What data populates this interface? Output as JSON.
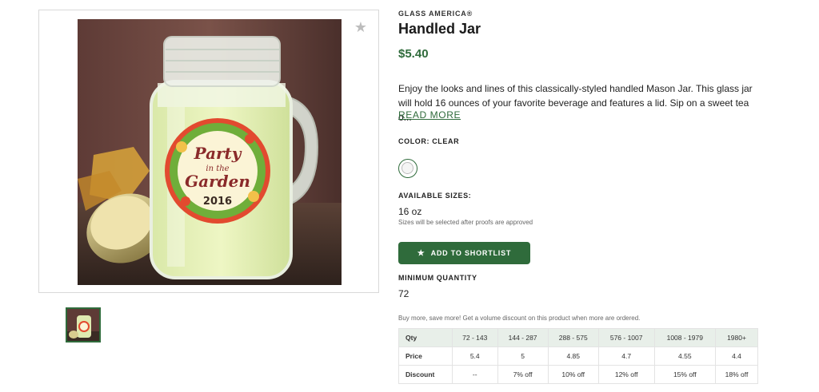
{
  "gallery": {
    "main_image_alt": "Handled Mason jar with lemonade and Party in the Garden 2016 label",
    "jar_label_lines": [
      "Party",
      "in the",
      "Garden",
      "2016"
    ],
    "thumbnail_alt": "Handled Jar thumbnail"
  },
  "product": {
    "brand": "GLASS AMERICA®",
    "title": "Handled Jar",
    "price": "$5.40",
    "description": "Enjoy the looks and lines of this classically-styled handled Mason Jar. This glass jar will hold 16 ounces of your favorite beverage and features a lid. Sip on a sweet tea o...",
    "read_more": "READ MORE"
  },
  "color": {
    "label": "COLOR: CLEAR",
    "swatch_name": "Clear"
  },
  "sizes": {
    "label": "AVAILABLE SIZES:",
    "value": "16 oz",
    "note": "Sizes will be selected after proofs are approved"
  },
  "actions": {
    "add_shortlist": "ADD TO SHORTLIST"
  },
  "min_qty": {
    "label": "MINIMUM QUANTITY",
    "value": "72"
  },
  "volume": {
    "note": "Buy more, save more! Get a volume discount on this product when more are ordered.",
    "rows": [
      [
        "Qty",
        "72 - 143",
        "144 - 287",
        "288 - 575",
        "576 - 1007",
        "1008 - 1979",
        "1980+"
      ],
      [
        "Price",
        "5.4",
        "5",
        "4.85",
        "4.7",
        "4.55",
        "4.4"
      ],
      [
        "Discount",
        "--",
        "7% off",
        "10% off",
        "12% off",
        "15% off",
        "18% off"
      ]
    ]
  },
  "colors": {
    "accent_green": "#2f6b3b",
    "table_header_bg": "#e8efe9"
  },
  "icons": {
    "favorite": "star-icon",
    "shortlist": "star-icon"
  }
}
